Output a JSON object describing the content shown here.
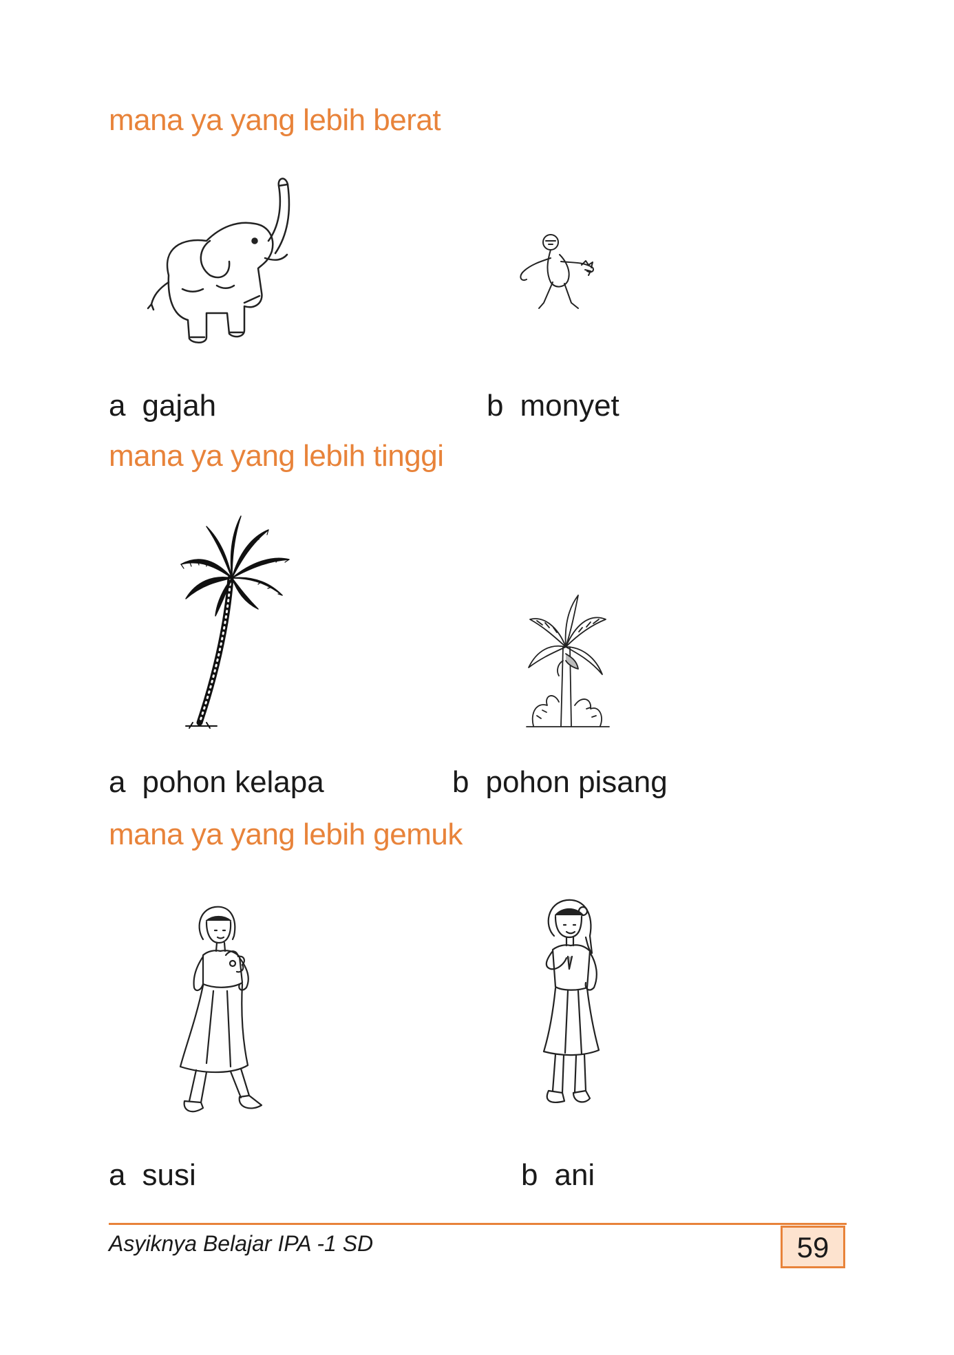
{
  "questions": [
    {
      "title": "mana ya yang lebih berat",
      "option_a": {
        "letter": "a",
        "label": "gajah",
        "illustration": "elephant-illustration"
      },
      "option_b": {
        "letter": "b",
        "label": "monyet",
        "illustration": "monkey-illustration"
      }
    },
    {
      "title": "mana ya yang lebih tinggi",
      "option_a": {
        "letter": "a",
        "label": "pohon kelapa",
        "illustration": "coconut-tree-illustration"
      },
      "option_b": {
        "letter": "b",
        "label": "pohon pisang",
        "illustration": "banana-tree-illustration"
      }
    },
    {
      "title": "mana ya yang lebih gemuk",
      "option_a": {
        "letter": "a",
        "label": "susi",
        "illustration": "girl-susi-illustration"
      },
      "option_b": {
        "letter": "b",
        "label": "ani",
        "illustration": "girl-ani-illustration"
      }
    }
  ],
  "footer": {
    "book_title": "Asyiknya Belajar IPA -1 SD",
    "page_number": "59"
  },
  "colors": {
    "accent": "#e8833a",
    "page_number_fill": "#fde3cf",
    "text": "#1a1a1a"
  }
}
